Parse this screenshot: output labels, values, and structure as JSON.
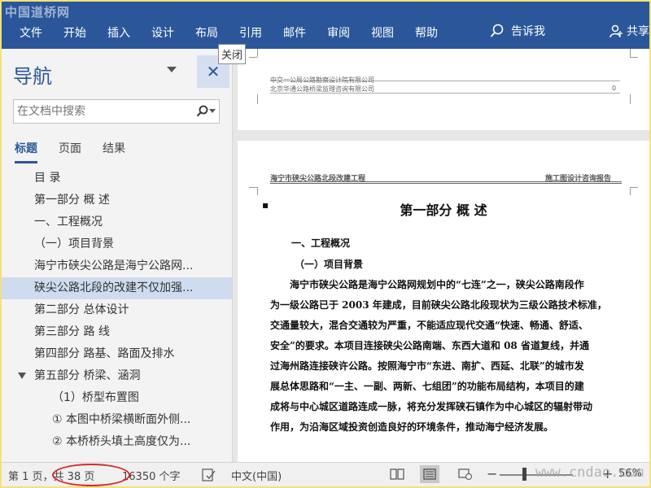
{
  "ribbon": {
    "watermark": "中国道桥网",
    "menu": [
      "文件",
      "开始",
      "插入",
      "设计",
      "布局",
      "引用",
      "邮件",
      "审阅",
      "视图",
      "帮助"
    ],
    "tell_me": "告诉我",
    "share": "共享",
    "bg_color": "#2b579a"
  },
  "nav": {
    "title": "导航",
    "close_symbol": "✕",
    "close_tooltip": "关闭",
    "search_placeholder": "在文档中搜索",
    "tabs": [
      "标题",
      "页面",
      "结果"
    ],
    "headings": [
      {
        "label": "目  录",
        "level": 1
      },
      {
        "label": "第一部分  概  述",
        "level": 1
      },
      {
        "label": "一、工程概况",
        "level": 1
      },
      {
        "label": "（一）项目背景",
        "level": 1
      },
      {
        "label": "海宁市硖尖公路是海宁公路网...",
        "level": 1
      },
      {
        "label": "硖尖公路北段的改建不仅加强...",
        "level": 1,
        "selected": true
      },
      {
        "label": "第二部分 总体设计",
        "level": 1
      },
      {
        "label": "第三部分  路  线",
        "level": 1
      },
      {
        "label": "第四部分 路基、路面及排水",
        "level": 1
      },
      {
        "label": "第五部分 桥梁、涵洞",
        "level": 1,
        "expanded": true
      },
      {
        "label": "（1）桥型布置图",
        "level": 2
      },
      {
        "label": "① 本图中桥梁横断面外侧...",
        "level": 2
      },
      {
        "label": "② 本桥桥头填土高度仅为...",
        "level": 2
      }
    ]
  },
  "document": {
    "page1_header_line1": "中交一公局公路勘察设计院有限公司",
    "page1_header_line2": "北京华通公路桥梁监理咨询有限公司",
    "page1_page_no": "0",
    "page2_header_left": "海宁市硖尖公路北段改建工程",
    "page2_header_right": "施工图设计咨询报告",
    "bullet": "▪",
    "title": "第一部分  概  述",
    "h1": "一、工程概况",
    "h2": "（一）项目背景",
    "body": [
      "海宁市硖尖公路是海宁公路网规划中的“七连”之一，硖尖公路南段作",
      "为一级公路已于 2003 年建成，目前硖尖公路北段现状为三级公路技术标准，",
      "交通量较大，混合交通较为严重，不能适应现代交通“快速、畅通、舒适、",
      "安全”的要求。本项目连接硖尖公路南端、东西大道和 08 省道复线，并通",
      "过海州路连接硖许公路。按照海宁市“东进、南扩、西延、北联”的城市发",
      "展总体思路和“一主、一副、两新、七组团”的功能布局结构，本项目的建",
      "成将与中心城区道路连成一脉，将充分发挥硖石镇作为中心城区的辐射带动",
      "作用，为沿海区域投资创造良好的环境条件，推动海宁经济发展。"
    ]
  },
  "status": {
    "page": "第 1 页，共 38 页",
    "words": "16350 个字",
    "language": "中文(中国)",
    "zoom_minus": "−",
    "zoom_plus": "+",
    "zoom": "56%",
    "watermark": "www.cndao.com"
  }
}
